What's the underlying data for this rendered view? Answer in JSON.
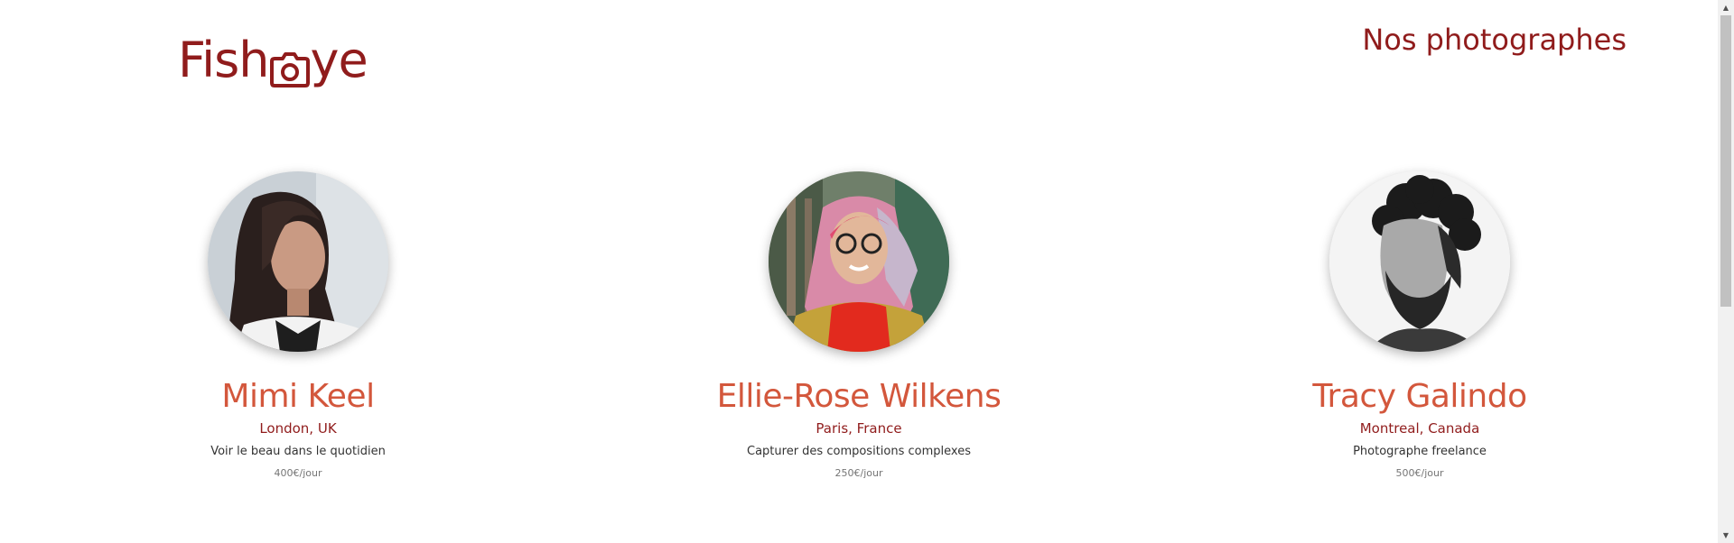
{
  "header": {
    "logo_alt": "Fisheye",
    "logo_left": "Fish",
    "logo_right": "ye",
    "heading": "Nos photographes"
  },
  "photographers": [
    {
      "name": "Mimi Keel",
      "location": "London, UK",
      "tagline": "Voir le beau dans le quotidien",
      "price": "400€/jour"
    },
    {
      "name": "Ellie-Rose Wilkens",
      "location": "Paris, France",
      "tagline": "Capturer des compositions complexes",
      "price": "250€/jour"
    },
    {
      "name": "Tracy Galindo",
      "location": "Montreal, Canada",
      "tagline": "Photographe freelance",
      "price": "500€/jour"
    }
  ],
  "icons": {
    "logo_camera": "camera-icon",
    "scroll_up": "chevron-up-icon",
    "scroll_down": "chevron-down-icon"
  },
  "colors": {
    "brand": "#901c1c",
    "name_accent": "#d3573c",
    "tagline": "#333333",
    "price": "#757575"
  }
}
